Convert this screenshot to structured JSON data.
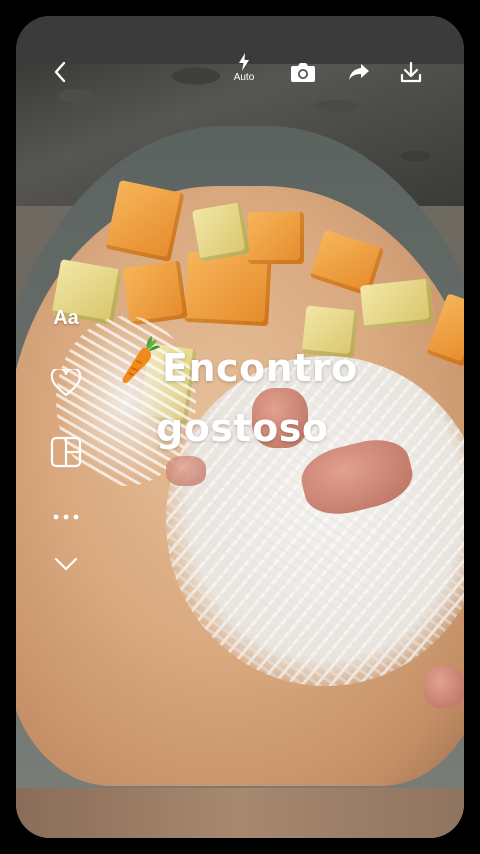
{
  "topbar": {
    "back_icon": "chevron-left-icon",
    "flash_icon": "flash-icon",
    "flash_label": "Auto",
    "camera_icon": "camera-icon",
    "share_icon": "share-arrow-icon",
    "download_icon": "download-icon"
  },
  "side_tools": {
    "text_tool_label": "Aa",
    "like_icon": "heart-icon",
    "layout_icon": "layout-icon",
    "more_icon": "more-dots-icon",
    "expand_icon": "chevron-down-icon"
  },
  "caption": {
    "emoji": "carrot-emoji",
    "line1": "Encontro",
    "line2": "gostoso"
  },
  "colors": {
    "overlay_text": "#ffffff",
    "background": "#000000"
  }
}
